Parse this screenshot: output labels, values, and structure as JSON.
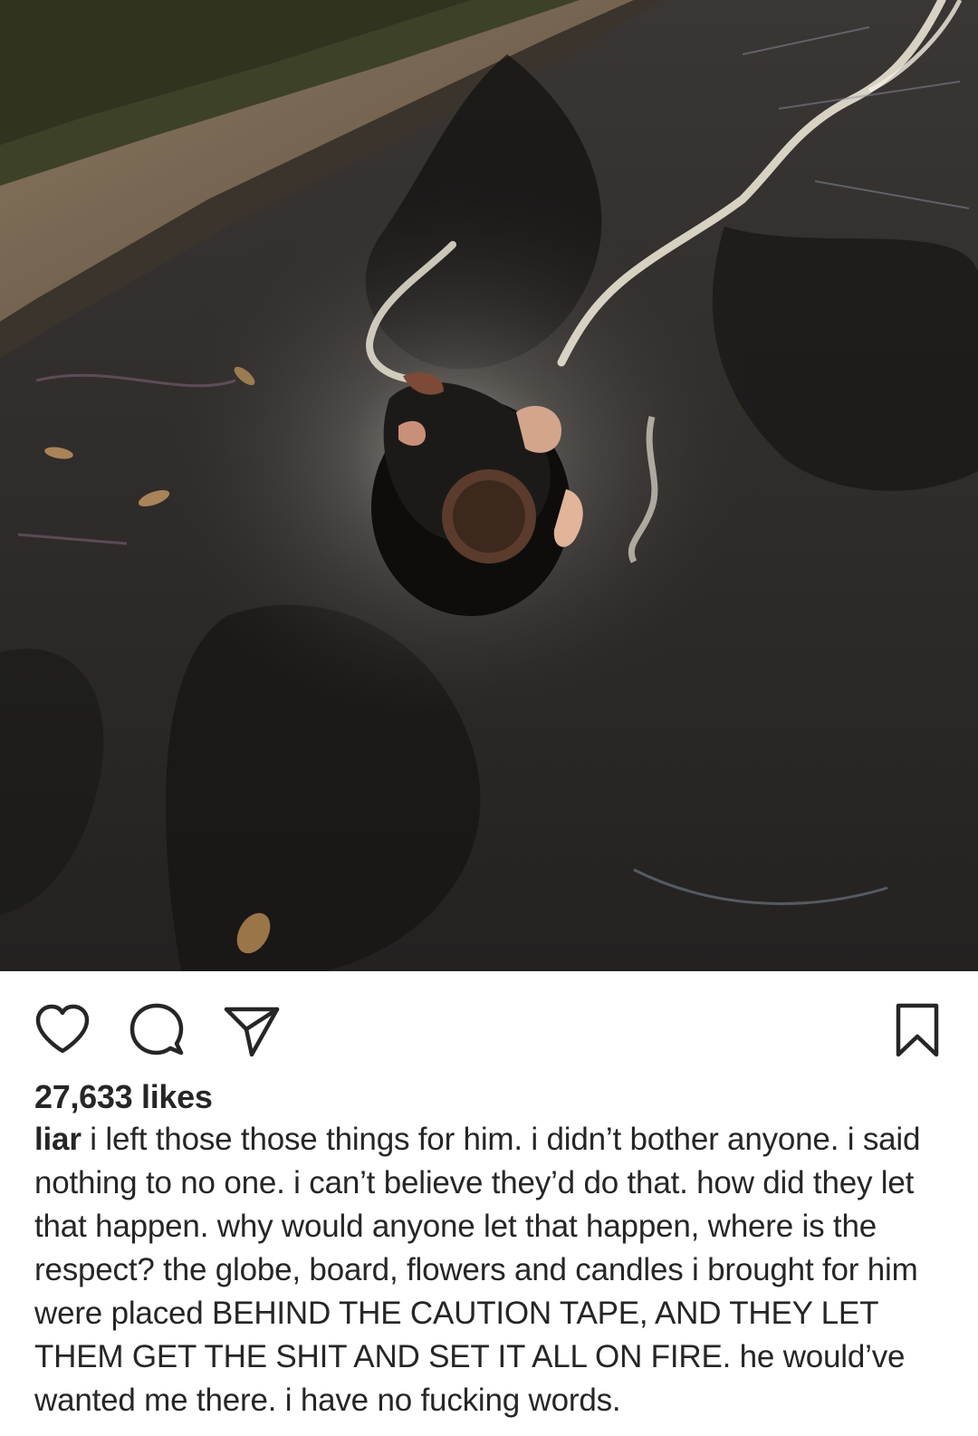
{
  "photo": {
    "alt_icon": "photo-of-burned-memorial-on-wet-asphalt"
  },
  "actions": {
    "like_icon": "heart-outline-icon",
    "comment_icon": "comment-bubble-icon",
    "share_icon": "paper-plane-icon",
    "save_icon": "bookmark-icon"
  },
  "likes": {
    "count": "27,633",
    "suffix": "likes"
  },
  "caption": {
    "username": "liar",
    "text": "i left those those things for him. i didn’t bother anyone. i said nothing to no one. i can’t believe they’d do that. how did they let that happen. why would anyone let that happen, where is the respect? the globe, board, flowers and candles i brought for him were placed BEHIND THE CAUTION TAPE, AND THEY LET THEM GET THE SHIT AND SET IT ALL ON FIRE. he would’ve wanted me there. i have no fucking words."
  },
  "colors": {
    "text": "#262626",
    "background": "#ffffff",
    "asphalt": "#2a2827",
    "curb": "#7a6a52"
  }
}
